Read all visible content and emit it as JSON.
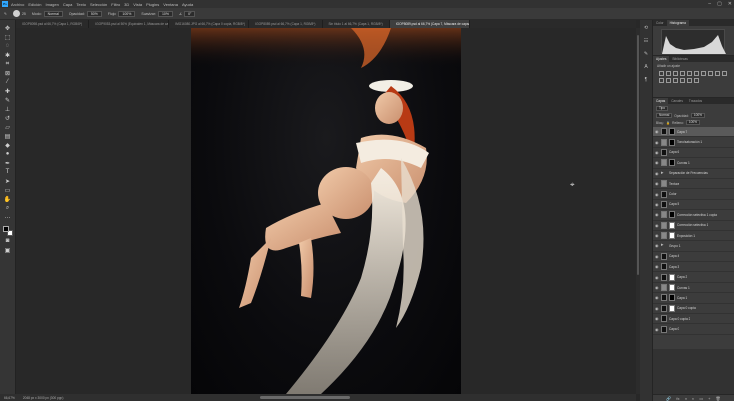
{
  "app": {
    "logo": "Ps"
  },
  "menu": [
    "Archivo",
    "Edición",
    "Imagen",
    "Capa",
    "Texto",
    "Selección",
    "Filtro",
    "3D",
    "Vista",
    "Plugins",
    "Ventana",
    "Ayuda"
  ],
  "window_controls": [
    "–",
    "▢",
    "✕"
  ],
  "options": {
    "size": "25",
    "mode_label": "Modo:",
    "mode_value": "Normal",
    "opacity_label": "Opacidad:",
    "opacity_value": "50%",
    "flow_label": "Flujo:",
    "flow_value": "100%",
    "smoothing_label": "Suavizar:",
    "smoothing_value": "10%",
    "angle_value": "0°"
  },
  "tabs": [
    {
      "label": "IGOP8098.psd al 66,7% (Capa 1, RGB/8*)",
      "active": false
    },
    {
      "label": "IGOP9053.psd al 50% (Equivalen 1, Máscara de capa/8)",
      "active": false
    },
    {
      "label": "IMG16080.JPG al 66,7% (Capa 0 copia, RGB/8*)",
      "active": false
    },
    {
      "label": "IGOP8089.psd al 66,7% (Capa 1, RGB/8*)",
      "active": false
    },
    {
      "label": "Sin título 1 al 66,7% (Capa 1, RGB/8*)",
      "active": false
    },
    {
      "label": "IGOP8089.psd al 66,7% (Capa 7, Máscara de capa/8)",
      "active": true
    }
  ],
  "status": {
    "zoom": "66,67%",
    "doc_size": "2048 px x 3000 px (300 ppp)"
  },
  "panels": {
    "top_tabs": [
      "Color",
      "Histograma"
    ],
    "adjust_tabs": [
      "Ajustes",
      "Bibliotecas"
    ],
    "adjust_title": "Añadir un ajuste",
    "layers_tabs": [
      "Capas",
      "Canales",
      "Trazados"
    ],
    "filter_label": "Tipo",
    "blend_mode": "Normal",
    "opacity_label": "Opacidad:",
    "opacity_value": "100%",
    "lock_label": "Bloq.:",
    "fill_label": "Relleno:",
    "fill_value": "100%"
  },
  "layers": [
    {
      "name": "Capa 7",
      "thumb": "black",
      "mask": "black",
      "selected": true
    },
    {
      "name": "Tono/saturación 1",
      "thumb": "adj",
      "mask": "black",
      "selected": false
    },
    {
      "name": "Capa 6",
      "thumb": "black",
      "mask": "",
      "selected": false
    },
    {
      "name": "Curvas 1",
      "thumb": "adj",
      "mask": "black",
      "selected": false
    },
    {
      "name": "Separación de Frecuencias",
      "thumb": "group",
      "mask": "",
      "selected": false
    },
    {
      "name": "Textura",
      "thumb": "adj",
      "mask": "",
      "selected": false
    },
    {
      "name": "Color",
      "thumb": "black",
      "mask": "",
      "selected": false
    },
    {
      "name": "Capa 5",
      "thumb": "black",
      "mask": "",
      "selected": false
    },
    {
      "name": "Corrección selectiva 1 copia",
      "thumb": "adj",
      "mask": "black",
      "selected": false
    },
    {
      "name": "Corrección selectiva 1",
      "thumb": "adj",
      "mask": "white",
      "selected": false
    },
    {
      "name": "Exposición 1",
      "thumb": "adj",
      "mask": "white",
      "selected": false
    },
    {
      "name": "Grupo 1",
      "thumb": "group",
      "mask": "",
      "selected": false
    },
    {
      "name": "Capa 4",
      "thumb": "black",
      "mask": "",
      "selected": false
    },
    {
      "name": "Capa 3",
      "thumb": "black",
      "mask": "",
      "selected": false
    },
    {
      "name": "Capa 2",
      "thumb": "black",
      "mask": "white",
      "selected": false
    },
    {
      "name": "Curvas 1",
      "thumb": "adj",
      "mask": "white",
      "selected": false
    },
    {
      "name": "Capa 1",
      "thumb": "black",
      "mask": "black",
      "selected": false
    },
    {
      "name": "Capa 0 copia",
      "thumb": "black",
      "mask": "white",
      "selected": false
    },
    {
      "name": "Capa 0 copia 2",
      "thumb": "black",
      "mask": "",
      "selected": false
    },
    {
      "name": "Capa 0",
      "thumb": "black",
      "mask": "",
      "selected": false
    }
  ],
  "layers_footer": [
    "🔗",
    "fx",
    "◑",
    "◐",
    "▭",
    "+",
    "🗑"
  ]
}
